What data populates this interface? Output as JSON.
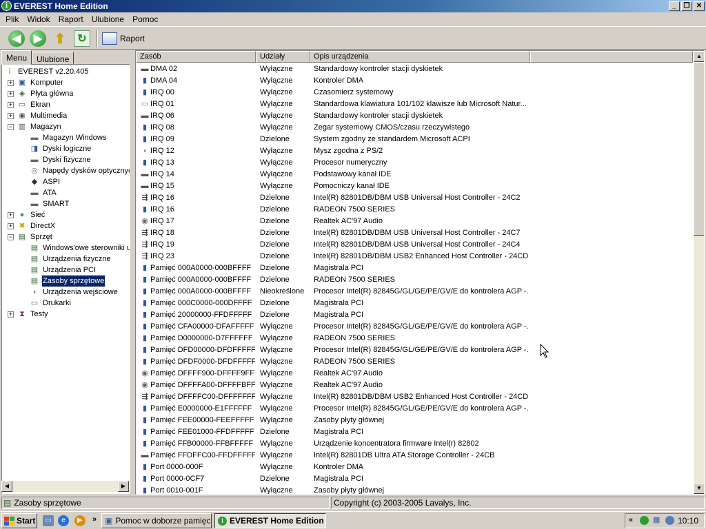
{
  "window": {
    "title": "EVEREST Home Edition",
    "controls": {
      "minimize": "_",
      "restore": "❐",
      "close": "✕"
    }
  },
  "menubar": [
    "Plik",
    "Widok",
    "Raport",
    "Ulubione",
    "Pomoc"
  ],
  "toolbar": {
    "report_label": "Raport"
  },
  "tabs": [
    "Menu",
    "Ulubione"
  ],
  "tree": [
    {
      "label": "EVEREST v2.20.405",
      "level": 0,
      "expander": "",
      "icon": "info-icon"
    },
    {
      "label": "Komputer",
      "level": 1,
      "expander": "+",
      "icon": "computer-icon"
    },
    {
      "label": "Płyta główna",
      "level": 1,
      "expander": "+",
      "icon": "motherboard-icon"
    },
    {
      "label": "Ekran",
      "level": 1,
      "expander": "+",
      "icon": "monitor-icon"
    },
    {
      "label": "Multimedia",
      "level": 1,
      "expander": "+",
      "icon": "speaker-icon"
    },
    {
      "label": "Magazyn",
      "level": 1,
      "expander": "−",
      "icon": "storage-icon"
    },
    {
      "label": "Magazyn Windows",
      "level": 2,
      "expander": "",
      "icon": "drive-icon"
    },
    {
      "label": "Dyski logiczne",
      "level": 2,
      "expander": "",
      "icon": "logical-disk-icon"
    },
    {
      "label": "Dyski fizyczne",
      "level": 2,
      "expander": "",
      "icon": "drive-icon"
    },
    {
      "label": "Napędy dysków optycznych",
      "level": 2,
      "expander": "",
      "icon": "cd-icon"
    },
    {
      "label": "ASPI",
      "level": 2,
      "expander": "",
      "icon": "aspi-icon"
    },
    {
      "label": "ATA",
      "level": 2,
      "expander": "",
      "icon": "drive-icon"
    },
    {
      "label": "SMART",
      "level": 2,
      "expander": "",
      "icon": "drive-icon"
    },
    {
      "label": "Sieć",
      "level": 1,
      "expander": "+",
      "icon": "globe-icon"
    },
    {
      "label": "DirectX",
      "level": 1,
      "expander": "+",
      "icon": "directx-icon"
    },
    {
      "label": "Sprzęt",
      "level": 1,
      "expander": "−",
      "icon": "hardware-icon"
    },
    {
      "label": "Windows'owe sterowniki urządzeń",
      "level": 2,
      "expander": "",
      "icon": "card-icon"
    },
    {
      "label": "Urządzenia fizyczne",
      "level": 2,
      "expander": "",
      "icon": "card-icon"
    },
    {
      "label": "Urządzenia PCI",
      "level": 2,
      "expander": "",
      "icon": "card-icon"
    },
    {
      "label": "Zasoby sprzętowe",
      "level": 2,
      "expander": "",
      "icon": "card-icon",
      "selected": true
    },
    {
      "label": "Urządzenia wejściowe",
      "level": 2,
      "expander": "",
      "icon": "mouse-icon"
    },
    {
      "label": "Drukarki",
      "level": 2,
      "expander": "",
      "icon": "printer-icon"
    },
    {
      "label": "Testy",
      "level": 1,
      "expander": "+",
      "icon": "hourglass-icon"
    }
  ],
  "list": {
    "columns": [
      "Zasób",
      "Udziały",
      "Opis urządzenia"
    ],
    "rows": [
      {
        "icon": "floppy-icon",
        "resource": "DMA 02",
        "share": "Wyłączne",
        "desc": "Standardowy kontroler stacji dyskietek"
      },
      {
        "icon": "device-icon",
        "resource": "DMA 04",
        "share": "Wyłączne",
        "desc": "Kontroler DMA"
      },
      {
        "icon": "device-icon",
        "resource": "IRQ 00",
        "share": "Wyłączne",
        "desc": "Czasomierz systemowy"
      },
      {
        "icon": "keyboard-icon",
        "resource": "IRQ 01",
        "share": "Wyłączne",
        "desc": "Standardowa klawiatura 101/102 klawisze lub Microsoft Natur..."
      },
      {
        "icon": "floppy-icon",
        "resource": "IRQ 06",
        "share": "Wyłączne",
        "desc": "Standardowy kontroler stacji dyskietek"
      },
      {
        "icon": "device-icon",
        "resource": "IRQ 08",
        "share": "Wyłączne",
        "desc": "Zegar systemowy CMOS/czasu rzeczywistego"
      },
      {
        "icon": "device-icon",
        "resource": "IRQ 09",
        "share": "Dzielone",
        "desc": "System zgodny ze standardem Microsoft ACPI"
      },
      {
        "icon": "mouse-icon",
        "resource": "IRQ 12",
        "share": "Wyłączne",
        "desc": "Mysz zgodna z PS/2"
      },
      {
        "icon": "device-icon",
        "resource": "IRQ 13",
        "share": "Wyłączne",
        "desc": "Procesor numeryczny"
      },
      {
        "icon": "ide-icon",
        "resource": "IRQ 14",
        "share": "Wyłączne",
        "desc": "Podstawowy kanał IDE"
      },
      {
        "icon": "ide-icon",
        "resource": "IRQ 15",
        "share": "Wyłączne",
        "desc": "Pomocniczy kanał IDE"
      },
      {
        "icon": "usb-icon",
        "resource": "IRQ 16",
        "share": "Dzielone",
        "desc": "Intel(R) 82801DB/DBM USB Universal Host Controller - 24C2"
      },
      {
        "icon": "device-icon",
        "resource": "IRQ 16",
        "share": "Dzielone",
        "desc": "RADEON 7500 SERIES"
      },
      {
        "icon": "audio-icon",
        "resource": "IRQ 17",
        "share": "Dzielone",
        "desc": "Realtek AC'97 Audio"
      },
      {
        "icon": "usb-icon",
        "resource": "IRQ 18",
        "share": "Dzielone",
        "desc": "Intel(R) 82801DB/DBM USB Universal Host Controller - 24C7"
      },
      {
        "icon": "usb-icon",
        "resource": "IRQ 19",
        "share": "Dzielone",
        "desc": "Intel(R) 82801DB/DBM USB Universal Host Controller - 24C4"
      },
      {
        "icon": "usb-icon",
        "resource": "IRQ 23",
        "share": "Dzielone",
        "desc": "Intel(R) 82801DB/DBM USB2 Enhanced Host Controller - 24CD"
      },
      {
        "icon": "device-icon",
        "resource": "Pamięć 000A0000-000BFFFF",
        "share": "Dzielone",
        "desc": "Magistrala PCI"
      },
      {
        "icon": "device-icon",
        "resource": "Pamięć 000A0000-000BFFFF",
        "share": "Dzielone",
        "desc": "RADEON 7500 SERIES"
      },
      {
        "icon": "device-icon",
        "resource": "Pamięć 000A0000-000BFFFF",
        "share": "Nieokreślone",
        "desc": "Procesor Intel(R) 82845G/GL/GE/PE/GV/E do kontrolera AGP -..."
      },
      {
        "icon": "device-icon",
        "resource": "Pamięć 000C0000-000DFFFF",
        "share": "Dzielone",
        "desc": "Magistrala PCI"
      },
      {
        "icon": "device-icon",
        "resource": "Pamięć 20000000-FFDFFFFF",
        "share": "Dzielone",
        "desc": "Magistrala PCI"
      },
      {
        "icon": "device-icon",
        "resource": "Pamięć CFA00000-DFAFFFFF",
        "share": "Wyłączne",
        "desc": "Procesor Intel(R) 82845G/GL/GE/PE/GV/E do kontrolera AGP -..."
      },
      {
        "icon": "device-icon",
        "resource": "Pamięć D0000000-D7FFFFFF",
        "share": "Wyłączne",
        "desc": "RADEON 7500 SERIES"
      },
      {
        "icon": "device-icon",
        "resource": "Pamięć DFD00000-DFDFFFFF",
        "share": "Wyłączne",
        "desc": "Procesor Intel(R) 82845G/GL/GE/PE/GV/E do kontrolera AGP -..."
      },
      {
        "icon": "device-icon",
        "resource": "Pamięć DFDF0000-DFDFFFFF",
        "share": "Wyłączne",
        "desc": "RADEON 7500 SERIES"
      },
      {
        "icon": "audio-icon",
        "resource": "Pamięć DFFFF900-DFFFF9FF",
        "share": "Wyłączne",
        "desc": "Realtek AC'97 Audio"
      },
      {
        "icon": "audio-icon",
        "resource": "Pamięć DFFFFA00-DFFFFBFF",
        "share": "Wyłączne",
        "desc": "Realtek AC'97 Audio"
      },
      {
        "icon": "usb-icon",
        "resource": "Pamięć DFFFFC00-DFFFFFFF",
        "share": "Wyłączne",
        "desc": "Intel(R) 82801DB/DBM USB2 Enhanced Host Controller - 24CD"
      },
      {
        "icon": "device-icon",
        "resource": "Pamięć E0000000-E1FFFFFF",
        "share": "Wyłączne",
        "desc": "Procesor Intel(R) 82845G/GL/GE/PE/GV/E do kontrolera AGP -..."
      },
      {
        "icon": "device-icon",
        "resource": "Pamięć FEE00000-FEEFFFFF",
        "share": "Wyłączne",
        "desc": "Zasoby płyty głównej"
      },
      {
        "icon": "device-icon",
        "resource": "Pamięć FEE01000-FFDFFFFF",
        "share": "Dzielone",
        "desc": "Magistrala PCI"
      },
      {
        "icon": "device-icon",
        "resource": "Pamięć FFB00000-FFBFFFFF",
        "share": "Wyłączne",
        "desc": "Urządzenie koncentratora firmware Intel(r) 82802"
      },
      {
        "icon": "ide-icon",
        "resource": "Pamięć FFDFFC00-FFDFFFFF",
        "share": "Wyłączne",
        "desc": "Intel(R) 82801DB Ultra ATA Storage Controller - 24CB"
      },
      {
        "icon": "device-icon",
        "resource": "Port 0000-000F",
        "share": "Wyłączne",
        "desc": "Kontroler DMA"
      },
      {
        "icon": "device-icon",
        "resource": "Port 0000-0CF7",
        "share": "Dzielone",
        "desc": "Magistrala PCI"
      },
      {
        "icon": "device-icon",
        "resource": "Port 0010-001F",
        "share": "Wyłączne",
        "desc": "Zasoby płyty głównej"
      }
    ]
  },
  "statusbar": {
    "left": "Zasoby sprzętowe",
    "right": "Copyright (c) 2003-2005 Lavalys, Inc."
  },
  "taskbar": {
    "start_label": "Start",
    "quicklaunch_more": "»",
    "tasks": [
      {
        "label": "Pomoc w doborze pamięc...",
        "active": false
      },
      {
        "label": "EVEREST Home Edition",
        "active": true
      }
    ],
    "tray_more": "«",
    "clock": "10:10"
  }
}
